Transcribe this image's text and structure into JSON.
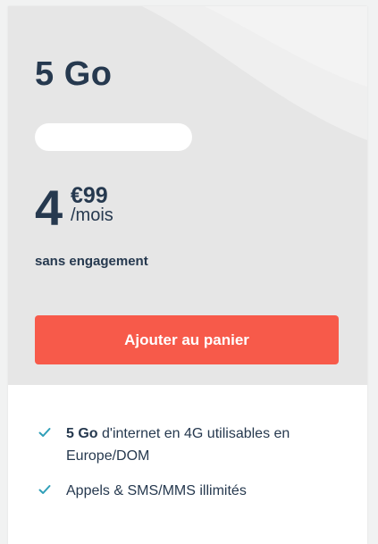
{
  "plan": {
    "title": "5 Go",
    "price_integer": "4",
    "price_cents": "€99",
    "price_unit": "/mois",
    "commitment": "sans engagement",
    "cta_label": "Ajouter au panier"
  },
  "features": [
    {
      "bold": "5 Go",
      "text": " d'internet en 4G utilisables en Europe/DOM",
      "icon": "check-icon"
    },
    {
      "bold": "",
      "text": "Appels & SMS/MMS illimités",
      "icon": "check-icon"
    }
  ],
  "colors": {
    "text_primary": "#26394f",
    "cta_background": "#f75a4a",
    "check": "#2f9fb8",
    "card_top_background": "#e6e6e6"
  }
}
